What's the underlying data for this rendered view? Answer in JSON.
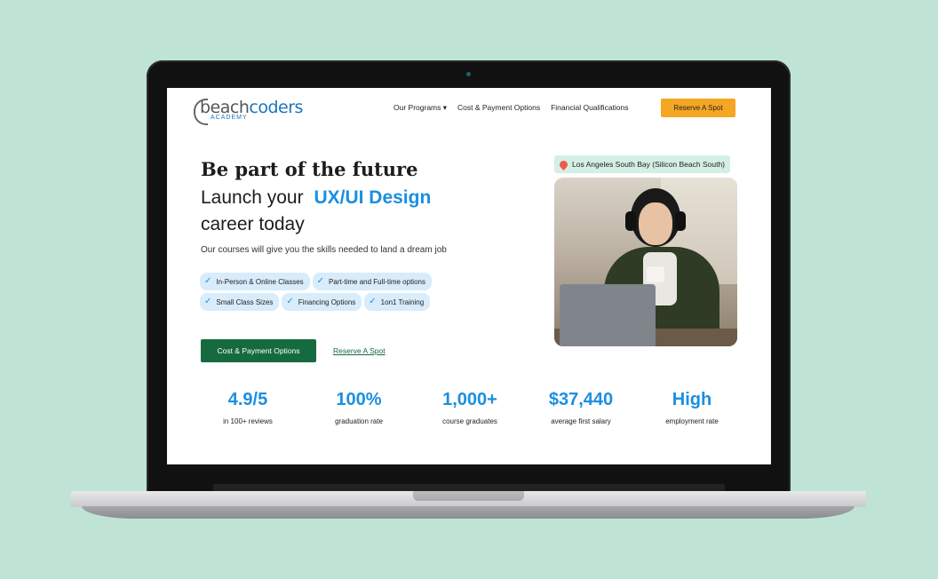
{
  "site": {
    "logo": {
      "part1": "beach",
      "part2": "coders",
      "sub": "ACADEMY"
    },
    "nav": {
      "items": [
        "Our Programs ▾",
        "Cost & Payment Options",
        "Financial Qualifications"
      ],
      "reserve_button": "Reserve A Spot"
    },
    "hero": {
      "title": "Be part of the future",
      "line1_prefix": "Launch your",
      "line1_highlight": "UX/UI Design",
      "line2": "career today",
      "subtitle": "Our courses will give you the skills needed to land a dream job",
      "features": [
        "In-Person & Online Classes",
        "Part-time and Full-time options",
        "Small Class Sizes",
        "Financing Options",
        "1on1 Training"
      ],
      "primary_cta": "Cost & Payment Options",
      "secondary_cta": "Reserve A Spot",
      "location": "Los Angeles South Bay (Silicon Beach South)"
    },
    "stats": [
      {
        "value": "4.9/5",
        "label": "in 100+ reviews"
      },
      {
        "value": "100%",
        "label": "graduation rate"
      },
      {
        "value": "1,000+",
        "label": "course graduates"
      },
      {
        "value": "$37,440",
        "label": "average first salary"
      },
      {
        "value": "High",
        "label": "employment rate"
      }
    ]
  },
  "colors": {
    "background": "#bfe4d6",
    "accent_blue": "#1b8fe0",
    "cta_green": "#156b3f",
    "reserve_orange": "#f5a623"
  },
  "icons": [
    "check-icon",
    "location-pin-icon",
    "chevron-down-icon"
  ]
}
